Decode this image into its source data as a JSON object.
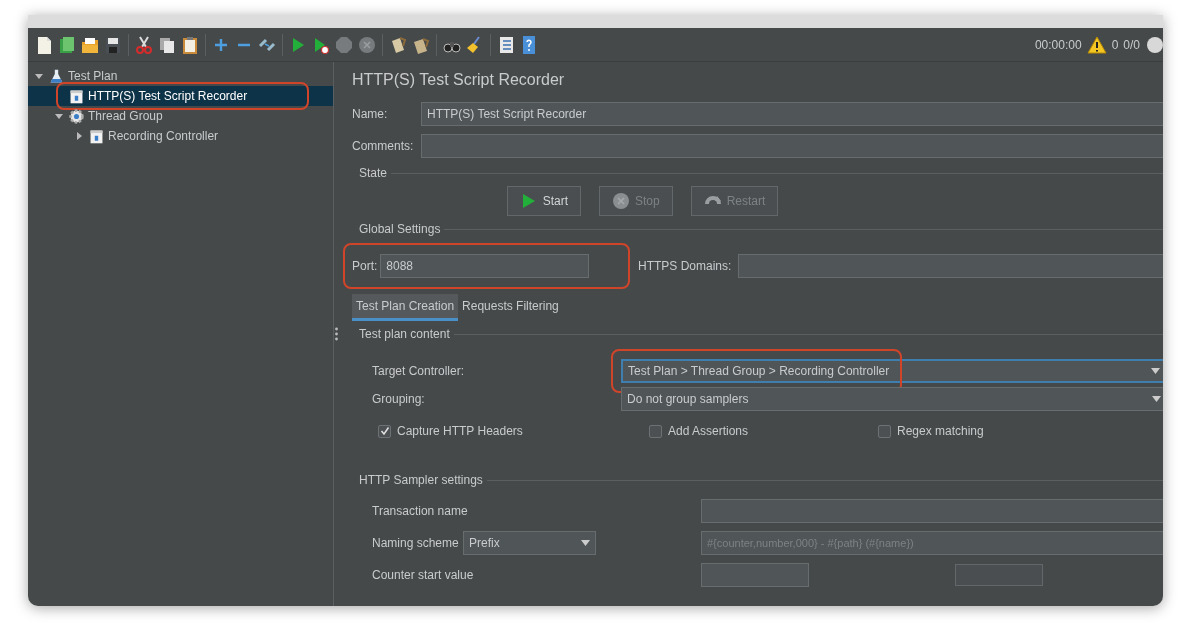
{
  "status": {
    "elapsed": "00:00:00",
    "warnings": "0",
    "threads": "0/0"
  },
  "tree": [
    {
      "label": "Test Plan",
      "kind": "plan",
      "expanded": true,
      "selected": false,
      "children": [
        {
          "label": "HTTP(S) Test Script Recorder",
          "kind": "recorder",
          "selected": true,
          "annotated": true
        },
        {
          "label": "Thread Group",
          "kind": "thread-group",
          "expanded": true,
          "selected": false,
          "children": [
            {
              "label": "Recording Controller",
              "kind": "controller",
              "expanded": false,
              "selected": false
            }
          ]
        }
      ]
    }
  ],
  "panel_title": "HTTP(S) Test Script Recorder",
  "name": {
    "label": "Name:",
    "value": "HTTP(S) Test Script Recorder"
  },
  "comments": {
    "label": "Comments:"
  },
  "state": {
    "title": "State",
    "buttons": [
      {
        "label": "Start",
        "kind": "start",
        "disabled": false
      },
      {
        "label": "Stop",
        "kind": "stop",
        "disabled": true
      },
      {
        "label": "Restart",
        "kind": "restart",
        "disabled": true
      }
    ]
  },
  "global_settings": {
    "title": "Global Settings",
    "port": {
      "label": "Port:",
      "value": "8088",
      "annotated": true
    },
    "https_domains": {
      "label": "HTTPS Domains:"
    }
  },
  "tabs": [
    {
      "label": "Test Plan Creation",
      "selected": true
    },
    {
      "label": "Requests Filtering",
      "selected": false
    }
  ],
  "test_plan_content": {
    "title": "Test plan content",
    "target_controller": {
      "label": "Target Controller:",
      "value": "Test Plan > Thread Group > Recording Controller",
      "annotated": true,
      "focused": true
    },
    "grouping": {
      "label": "Grouping:",
      "value": "Do not group samplers",
      "focused": false
    },
    "checkboxes": [
      {
        "label": "Capture HTTP Headers",
        "checked": true
      },
      {
        "label": "Add Assertions",
        "checked": false
      },
      {
        "label": "Regex matching",
        "checked": false
      }
    ]
  },
  "http_sampler_settings": {
    "title": "HTTP Sampler settings",
    "transaction_name": {
      "label": "Transaction name"
    },
    "naming_scheme": {
      "label": "Naming scheme",
      "value": "Prefix",
      "placeholder": "#{counter,number,000} - #{path} (#{name})"
    },
    "counter_start": {
      "label": "Counter start value"
    }
  }
}
